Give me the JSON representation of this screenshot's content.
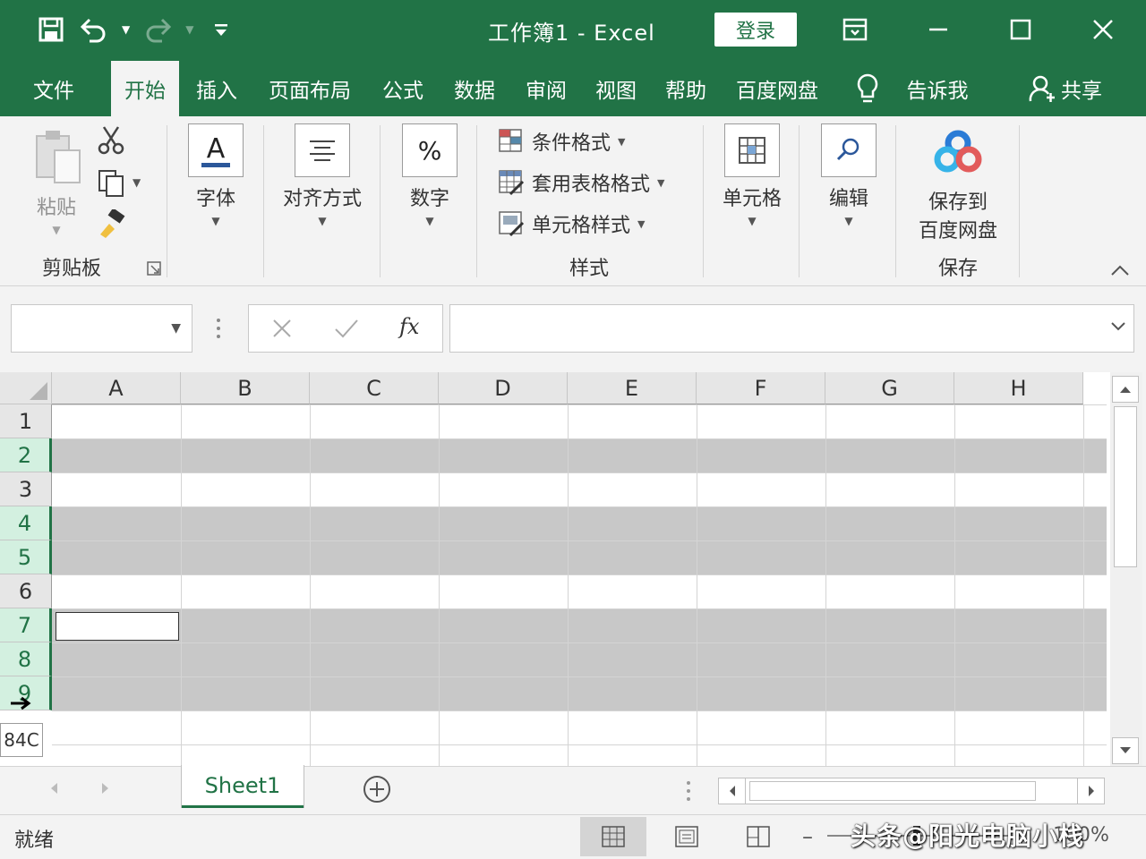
{
  "title_bar": {
    "title": "工作簿1  -  Excel",
    "login_label": "登录",
    "icons": [
      "save-icon",
      "undo-icon",
      "redo-icon",
      "customize-qat-icon",
      "ribbon-display-icon",
      "minimize-icon",
      "maximize-icon",
      "close-icon"
    ]
  },
  "menu": {
    "tabs": [
      "文件",
      "开始",
      "插入",
      "页面布局",
      "公式",
      "数据",
      "审阅",
      "视图",
      "帮助",
      "百度网盘"
    ],
    "active": "开始",
    "tellme_label": "告诉我",
    "share_label": "共享"
  },
  "ribbon": {
    "clipboard": {
      "paste_label": "粘贴",
      "group_label": "剪贴板"
    },
    "font_label": "字体",
    "align_label": "对齐方式",
    "number_label": "数字",
    "styles": {
      "items": [
        "条件格式",
        "套用表格格式",
        "单元格样式"
      ],
      "group_label": "样式"
    },
    "cells_label": "单元格",
    "edit_label": "编辑",
    "save": {
      "label_line1": "保存到",
      "label_line2": "百度网盘",
      "group_label": "保存"
    }
  },
  "formula_bar": {
    "name_box_value": "",
    "formula_value": "",
    "fx_label": "fx"
  },
  "grid": {
    "columns": [
      "A",
      "B",
      "C",
      "D",
      "E",
      "F",
      "G",
      "H"
    ],
    "rows": [
      "1",
      "2",
      "3",
      "4",
      "5",
      "6",
      "7",
      "8",
      "9"
    ],
    "shaded_rows": [
      2,
      4,
      5,
      7,
      8,
      9
    ],
    "selected_rows": [
      2,
      4,
      5,
      7,
      8,
      9
    ],
    "active_cell": "A7",
    "shade_color": "#c8c8c8",
    "tooltip_text": "84C"
  },
  "sheets": {
    "tabs": [
      "Sheet1"
    ],
    "active": "Sheet1"
  },
  "status": {
    "text": "就绪",
    "zoom": "100%"
  },
  "watermark": "头条@阳光电脑小栈",
  "colors": {
    "accent": "#217346"
  }
}
